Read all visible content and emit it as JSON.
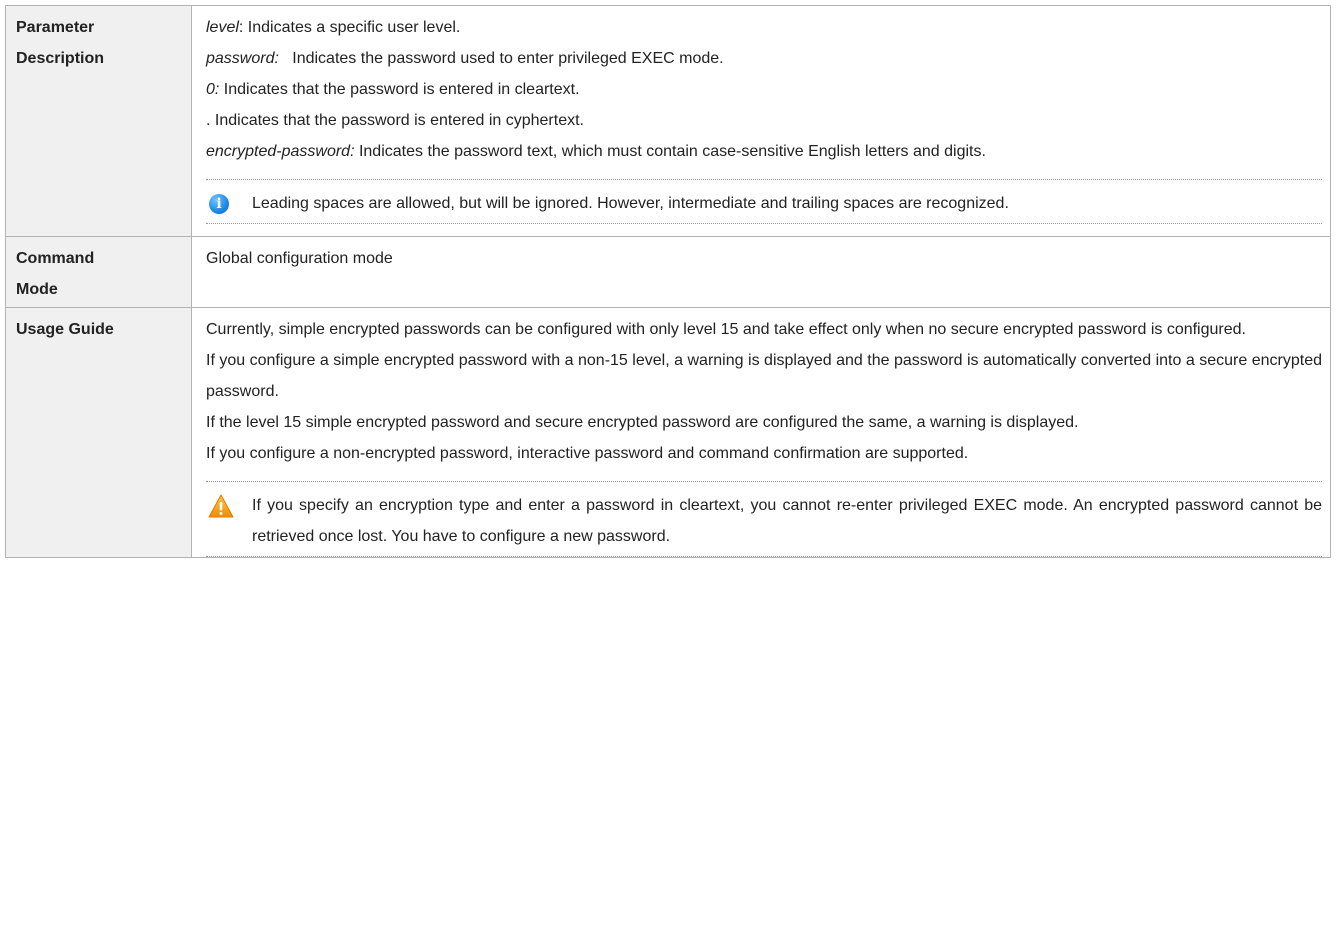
{
  "rows": {
    "parameter": {
      "label_line1": "Parameter",
      "label_line2": "Description",
      "lines": [
        {
          "term": "level",
          "text": ": Indicates a specific user level."
        },
        {
          "term": "password:",
          "text": "   Indicates the password used to enter privileged EXEC mode."
        },
        {
          "term": "0:",
          "text": " Indicates that the password is entered in cleartext."
        },
        {
          "term": "",
          "text": ". Indicates that the password is entered in cyphertext."
        },
        {
          "term": "encrypted-password:",
          "text": " Indicates the password text, which must contain case-sensitive English letters and digits."
        }
      ],
      "note": {
        "icon": "info-icon",
        "text": "Leading spaces are allowed, but will be ignored. However, intermediate and trailing spaces are recognized."
      }
    },
    "command_mode": {
      "label_line1": "Command",
      "label_line2": "Mode",
      "text": "Global configuration mode"
    },
    "usage_guide": {
      "label": "Usage Guide",
      "paragraphs": [
        "Currently, simple encrypted passwords can be configured with only level 15 and take effect only when no secure encrypted password is configured.",
        "If you configure a simple encrypted password with a non-15 level, a warning is displayed and the password is automatically converted into a secure encrypted password.",
        "If the level 15 simple encrypted password and secure encrypted password are configured the same, a warning is displayed.",
        "If you configure a non-encrypted password, interactive password and command confirmation are supported."
      ],
      "warning": {
        "icon": "warning-icon",
        "text": "If you specify an encryption type and enter a password in cleartext, you cannot re-enter privileged EXEC mode. An encrypted password cannot be retrieved once lost. You have to configure a new password."
      }
    }
  },
  "colors": {
    "label_bg": "#f0f0f0",
    "border": "#b3b3b3",
    "info_blue": "#1e88e5",
    "warning_orange": "#f5a623"
  }
}
